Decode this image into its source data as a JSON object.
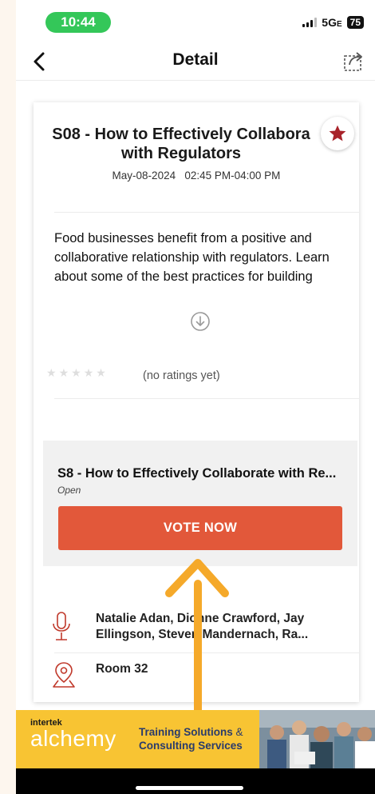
{
  "status_bar": {
    "time": "10:44",
    "network": "5G",
    "network_suffix": "E",
    "battery": "75"
  },
  "nav": {
    "title": "Detail",
    "back_icon": "chevron-left-icon",
    "share_icon": "share-icon"
  },
  "session": {
    "title_line1": "S08 - How to Effectively Collabora",
    "title_line2": "with Regulators",
    "date": "May-08-2024",
    "time_range": "02:45 PM-04:00 PM",
    "favorite_icon": "star-icon",
    "description": "Food businesses benefit from a positive and collaborative relationship with regulators. Learn about some of the best practices for building",
    "expand_icon": "chevron-down-circle-icon"
  },
  "ratings": {
    "stars": [
      "★",
      "★",
      "★",
      "★",
      "★"
    ],
    "label": "(no ratings yet)"
  },
  "survey": {
    "title": "S8 - How to Effectively Collaborate with Re...",
    "status": "Open",
    "vote_label": "VOTE NOW"
  },
  "speakers": {
    "icon": "microphone-icon",
    "line1": "Natalie Adan, Dionne Crawford, Jay",
    "line2": "Ellingson, Steven Mandernach, Ra..."
  },
  "room": {
    "icon": "map-pin-icon",
    "label": "Room 32"
  },
  "banner": {
    "brand_small": "intertek",
    "brand_big": "alchemy",
    "tagline_line1_a": "Training Solutions",
    "tagline_amp": " &",
    "tagline_line2": "Consulting Services"
  },
  "colors": {
    "accent": "#e2583a",
    "status_green": "#34c759",
    "favorite": "#a8232a",
    "annotation_arrow": "#f5a92a",
    "banner_bg": "#f8c433"
  }
}
